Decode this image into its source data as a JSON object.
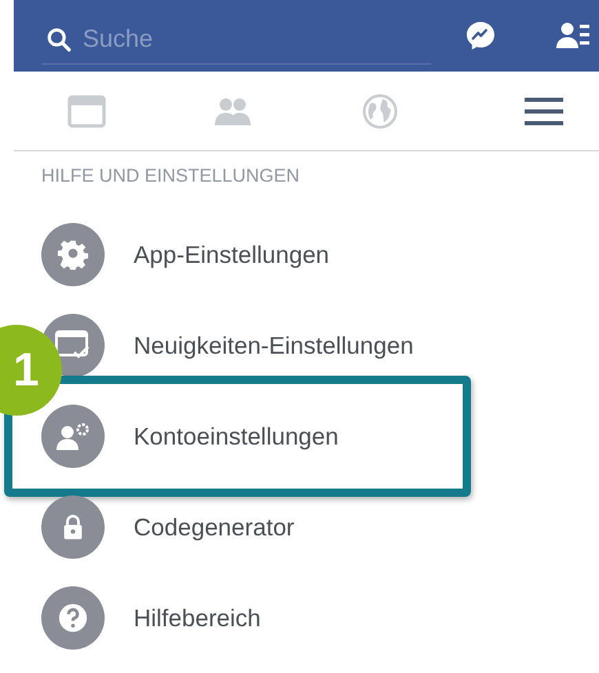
{
  "search": {
    "placeholder": "Suche"
  },
  "tabs": [
    {
      "kind": "feed",
      "selected": false
    },
    {
      "kind": "friends",
      "selected": false
    },
    {
      "kind": "globe",
      "selected": false
    },
    {
      "kind": "menu",
      "selected": true
    }
  ],
  "section": {
    "title": "HILFE UND EINSTELLUNGEN"
  },
  "items": [
    {
      "kind": "gear",
      "label": "App-Einstellungen",
      "highlighted": false
    },
    {
      "kind": "feed",
      "label": "Neuigkeiten-Einstellungen",
      "highlighted": false
    },
    {
      "kind": "account",
      "label": "Kontoeinstellungen",
      "highlighted": true
    },
    {
      "kind": "lock",
      "label": "Codegenerator",
      "highlighted": false
    },
    {
      "kind": "help",
      "label": "Hilfebereich",
      "highlighted": false
    }
  ],
  "callout": {
    "label": "1"
  }
}
